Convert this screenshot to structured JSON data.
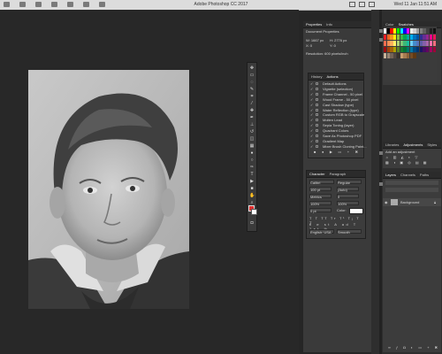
{
  "menubar": {
    "title": "Adobe Photoshop CC 2017",
    "clock": "Wed 11 Jan  11:51 AM"
  },
  "properties": {
    "tabs": [
      "Properties",
      "Info"
    ],
    "heading": "Document Properties",
    "w": "W: 1667 px",
    "h": "H: 2776 px",
    "x": "X: 0",
    "y": "Y: 0",
    "resolution": "Resolution: 600 pixels/inch"
  },
  "actions": {
    "tabs": [
      "History",
      "Actions"
    ],
    "items": [
      "Default Actions",
      "Vignette (selection)",
      "Frame Channel - 50 pixel",
      "Wood Frame - 50 pixel",
      "Cast Shadow (type)",
      "Water Reflection (type)",
      "Custom RGB to Grayscale",
      "Molten Lead",
      "Sepia Toning (layer)",
      "Quadrant Colors",
      "Save As Photoshop PDF",
      "Gradient Map",
      "Mixer Brush Cloning Paint..."
    ],
    "checked": [
      true,
      true,
      true,
      true,
      true,
      true,
      true,
      true,
      true,
      true,
      true,
      true,
      true
    ]
  },
  "character": {
    "tabs": [
      "Character",
      "Paragraph"
    ],
    "font": "Calibri",
    "style": "Regular",
    "size": "100 pt",
    "leading": "(Auto)",
    "kerning": "Metrics",
    "tracking": "0",
    "scale_v": "100%",
    "scale_h": "100%",
    "baseline": "0 pt",
    "color_label": "Color:",
    "language": "English: USA",
    "antialias": "Smooth"
  },
  "swatches_panel": {
    "tabs": [
      "Color",
      "Swatches"
    ]
  },
  "adjustments": {
    "tabs": [
      "Libraries",
      "Adjustments",
      "Styles"
    ],
    "add": "Add an adjustment"
  },
  "layers": {
    "tabs": [
      "Layers",
      "Channels",
      "Paths"
    ],
    "layer_name": "Background"
  },
  "colors": {
    "swatches": [
      "#ffffff",
      "#000000",
      "#ff0000",
      "#ffff00",
      "#00ff00",
      "#00ffff",
      "#0000ff",
      "#ff00ff",
      "#f0f0f0",
      "#d0d0d0",
      "#a0a0a0",
      "#808080",
      "#606060",
      "#404040",
      "#202020",
      "#101010",
      "#ed1c24",
      "#f26522",
      "#f7941d",
      "#fff200",
      "#8dc63f",
      "#39b54a",
      "#00a651",
      "#00a99d",
      "#00aeef",
      "#0072bc",
      "#0054a6",
      "#2e3192",
      "#662d91",
      "#92278f",
      "#ec008c",
      "#ed145b",
      "#f26c4f",
      "#f68e56",
      "#fbaf5d",
      "#fff568",
      "#acd373",
      "#7cc576",
      "#3cb878",
      "#1abc9c",
      "#6dcff6",
      "#448ccb",
      "#5674b9",
      "#605ca8",
      "#8560a8",
      "#a864a8",
      "#f06eaa",
      "#f26d7d",
      "#9e0b0f",
      "#a0410d",
      "#a36209",
      "#aba000",
      "#598527",
      "#197b30",
      "#007236",
      "#00746b",
      "#0076a3",
      "#004a80",
      "#003471",
      "#1b1464",
      "#440e62",
      "#630460",
      "#9e005d",
      "#9e0039",
      "#c7b299",
      "#998675",
      "#736357",
      "#534741",
      "#37302a",
      "#c69c6d",
      "#a67c52",
      "#8c6239",
      "#754c24",
      "#603913"
    ]
  }
}
